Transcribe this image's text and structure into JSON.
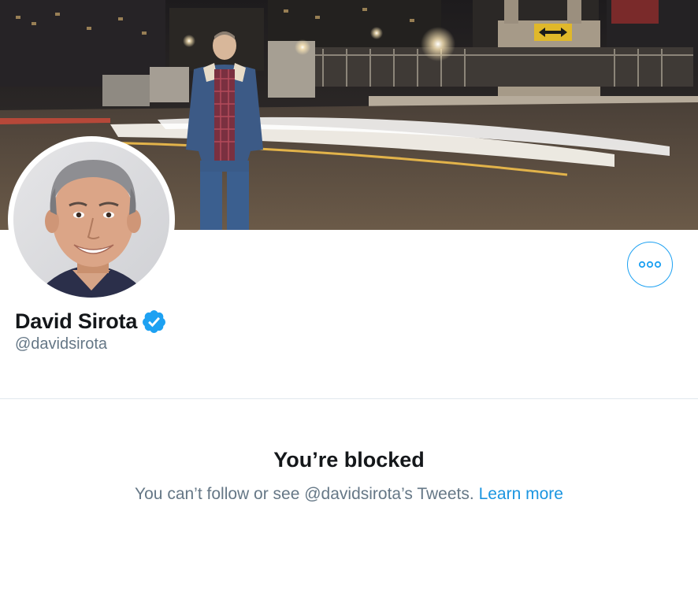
{
  "profile": {
    "display_name": "David Sirota",
    "handle": "@davidsirota",
    "verified": true
  },
  "icons": {
    "verified": "verified-badge-icon",
    "more": "more-options-icon"
  },
  "blocked": {
    "title": "You’re blocked",
    "message": "You can’t follow or see @davidsirota’s Tweets.",
    "learn_more": "Learn more"
  },
  "colors": {
    "accent": "#1da1f2",
    "link": "#1b95e0",
    "text_primary": "#14171a",
    "text_secondary": "#657786",
    "divider": "#e1e8ed"
  }
}
